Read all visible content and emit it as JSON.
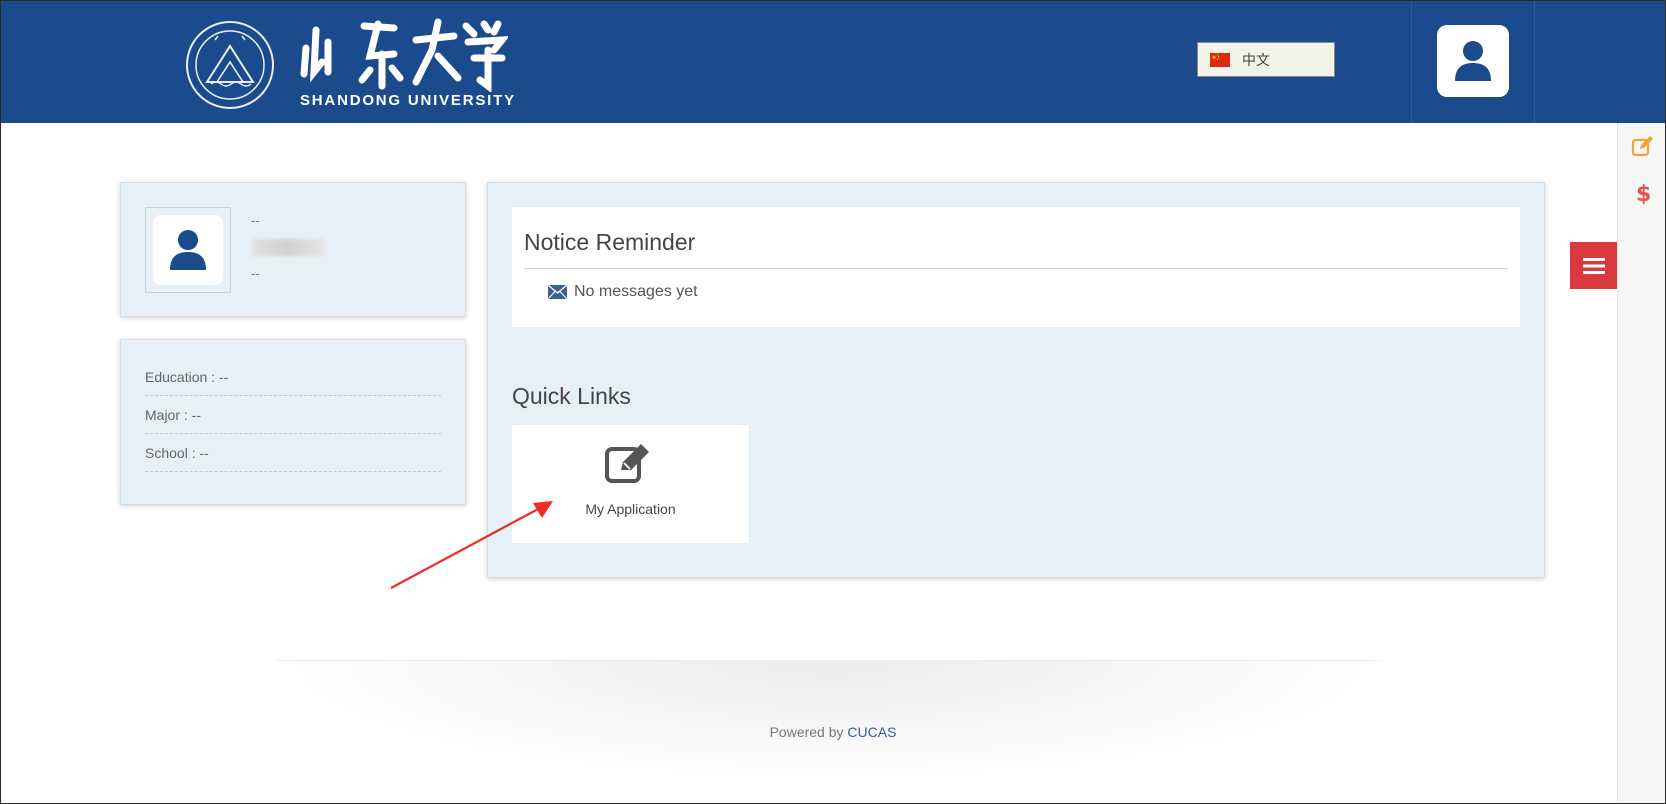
{
  "header": {
    "university_name_en": "SHANDONG UNIVERSITY",
    "language_button_label": "中文",
    "language_flag_icon": "china-flag-icon",
    "user_icon": "user-icon",
    "brand_color": "#1b4b8c"
  },
  "sidebar_right": {
    "edit_icon": "edit-icon",
    "payment_icon": "dollar-icon",
    "menu_icon": "hamburger-icon",
    "menu_color": "#d9383e"
  },
  "profile": {
    "line1": "--",
    "line3": "--"
  },
  "info": {
    "education": "Education : --",
    "major": "Major : --",
    "school": "School : --"
  },
  "notice": {
    "title": "Notice Reminder",
    "message": "No messages yet"
  },
  "quick_links": {
    "title": "Quick Links",
    "items": [
      {
        "label": "My Application",
        "icon": "edit-icon"
      }
    ]
  },
  "footer": {
    "prefix": "Powered by",
    "link": "CUCAS"
  }
}
